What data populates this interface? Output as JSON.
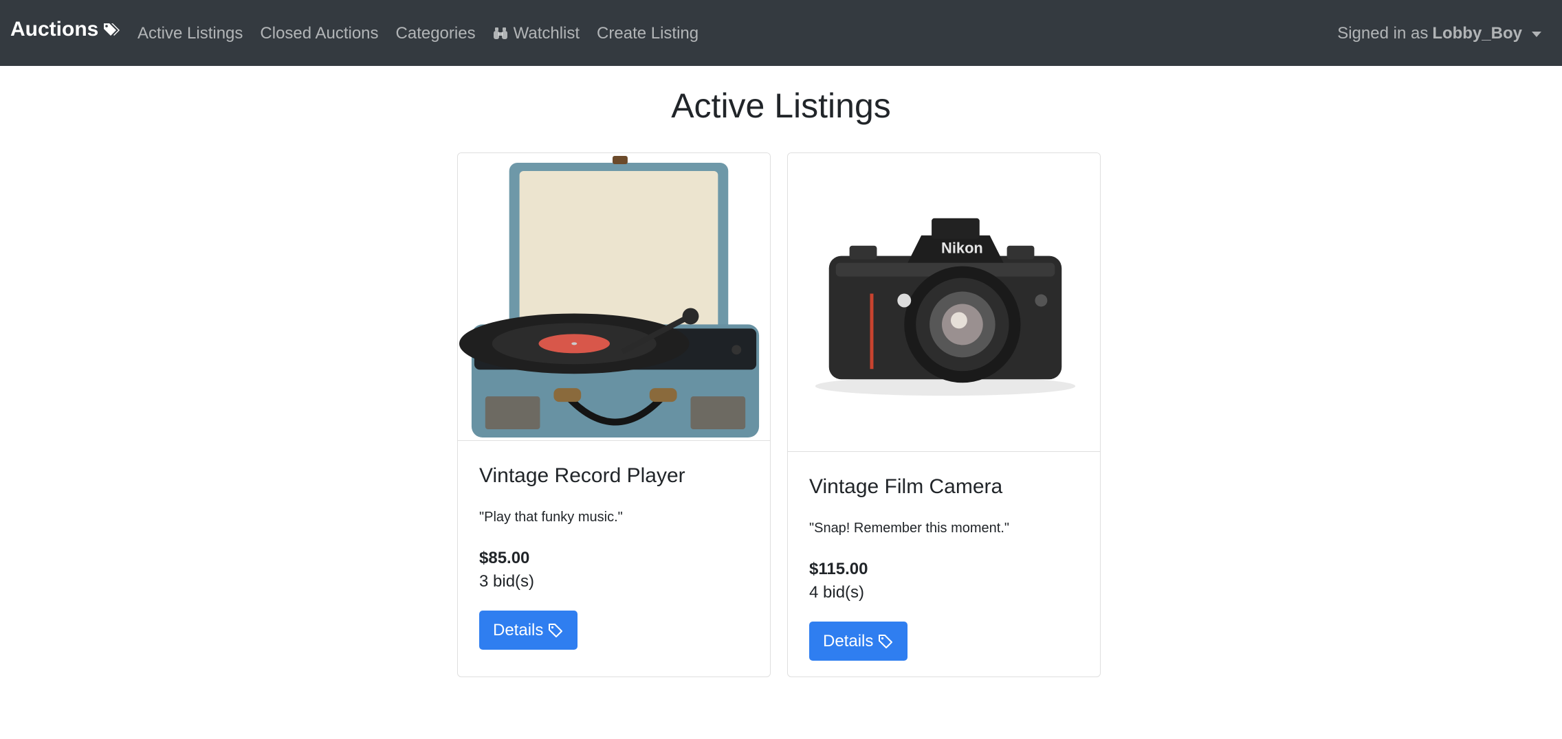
{
  "navbar": {
    "brand": "Auctions",
    "brand_icon": "tags-icon",
    "links": [
      {
        "label": "Active Listings"
      },
      {
        "label": "Closed Auctions"
      },
      {
        "label": "Categories"
      },
      {
        "label": "Watchlist",
        "icon": "binoculars-icon"
      },
      {
        "label": "Create Listing"
      }
    ],
    "user": {
      "prefix": "Signed in as",
      "name": "Lobby_Boy"
    }
  },
  "main": {
    "title": "Active Listings",
    "listings": [
      {
        "title": "Vintage Record Player",
        "description": "\"Play that funky music.\"",
        "price": "$85.00",
        "bids": "3 bid(s)",
        "button": "Details",
        "image": "record-player-image"
      },
      {
        "title": "Vintage Film Camera",
        "description": "\"Snap! Remember this moment.\"",
        "price": "$115.00",
        "bids": "4 bid(s)",
        "button": "Details",
        "image": "nikon-camera-image",
        "image_brand": "Nikon"
      }
    ]
  },
  "colors": {
    "navbar_bg": "#343a40",
    "button_bg": "#2f7ef0"
  }
}
